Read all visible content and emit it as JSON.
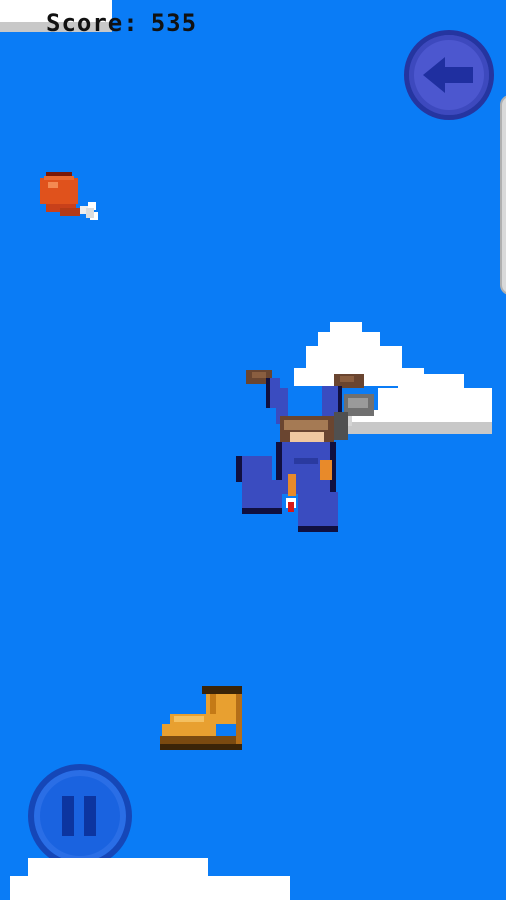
{
  "hud": {
    "score_label": "Score:",
    "score_value": "535"
  },
  "icons": {
    "back": "back-arrow-icon",
    "pause": "pause-icon",
    "food": "drumstick-icon",
    "boot": "boot-icon"
  },
  "colors": {
    "sky": "#0a7cf6",
    "cloud": "#ffffff",
    "cloud_shadow": "#c8c8c8",
    "button_back": "#4c57cf",
    "button_pause": "#1a63e0"
  }
}
